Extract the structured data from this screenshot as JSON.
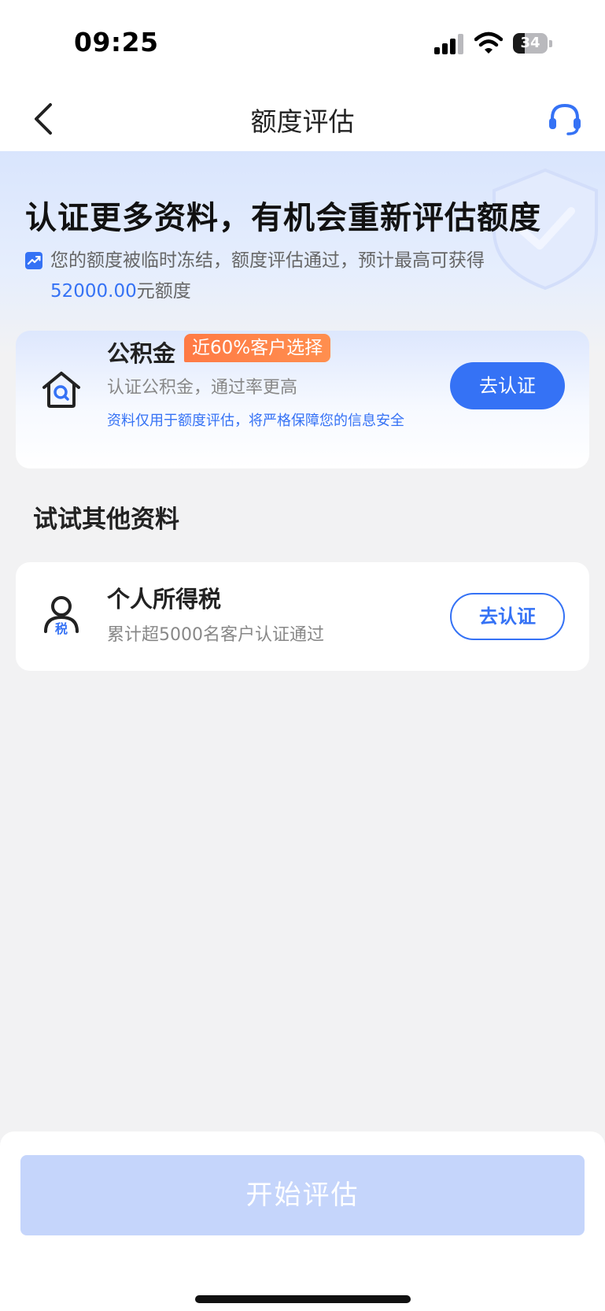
{
  "status_bar": {
    "time": "09:25",
    "battery_level": "34"
  },
  "nav": {
    "title": "额度评估",
    "back_icon": "chevron-left-icon",
    "service_icon": "headset-icon"
  },
  "hero": {
    "title": "认证更多资料，有机会重新评估额度",
    "desc_prefix": "您的额度被临时冻结，额度评估通过，预计最高可获得",
    "amount": "52000.00",
    "desc_suffix": "元额度"
  },
  "main_card": {
    "icon": "house-search-icon",
    "title": "公积金",
    "tag": "近60%客户选择",
    "subtitle": "认证公积金，通过率更高",
    "note": "资料仅用于额度评估，将严格保障您的信息安全",
    "button": "去认证"
  },
  "section_title": "试试其他资料",
  "tax_card": {
    "icon": "person-tax-icon",
    "icon_text": "税",
    "title": "个人所得税",
    "subtitle": "累计超5000名客户认证通过",
    "button": "去认证"
  },
  "bottom": {
    "start_button": "开始评估"
  },
  "colors": {
    "accent": "#3572f5",
    "tag": "#ff7a45",
    "disabled_button": "#c5d5fb"
  }
}
